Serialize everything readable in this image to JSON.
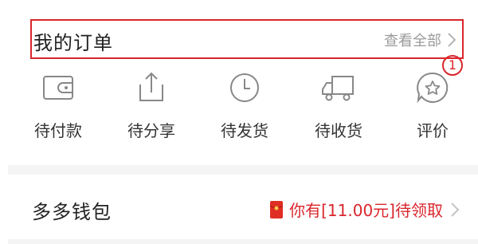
{
  "orders": {
    "title": "我的订单",
    "view_all": "查看全部",
    "badge_count": "1"
  },
  "order_statuses": [
    {
      "label": "待付款",
      "icon": "wallet-icon"
    },
    {
      "label": "待分享",
      "icon": "share-icon"
    },
    {
      "label": "待发货",
      "icon": "clock-icon"
    },
    {
      "label": "待收货",
      "icon": "truck-icon"
    },
    {
      "label": "评价",
      "icon": "review-icon"
    }
  ],
  "wallet": {
    "title": "多多钱包",
    "promo": "你有[11.00元]待领取"
  },
  "colors": {
    "accent": "#d9262c",
    "icon_stroke": "#888888",
    "muted_text": "#9a9a9a"
  }
}
